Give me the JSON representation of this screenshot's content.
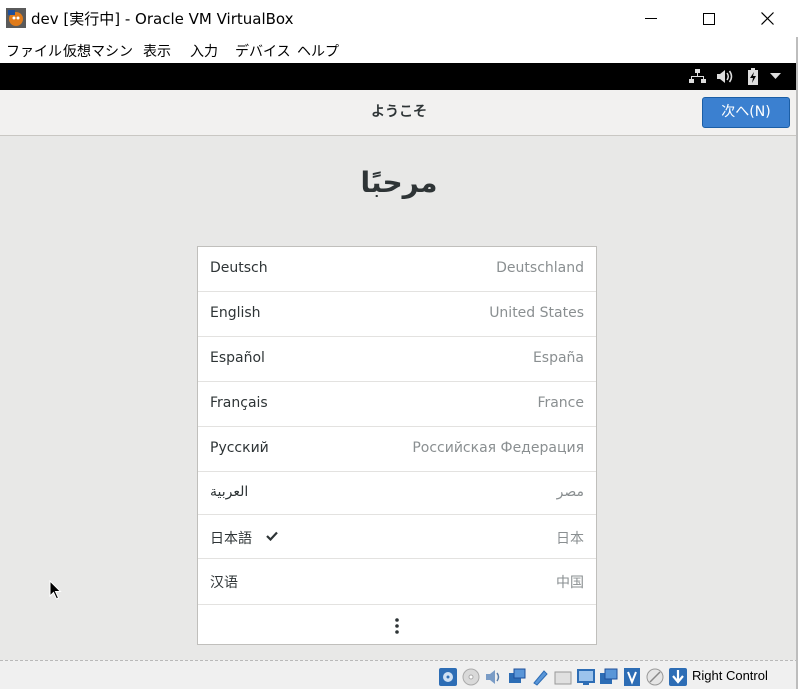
{
  "window": {
    "title": "dev [実行中] - Oracle VM VirtualBox"
  },
  "menubar": {
    "items": [
      "ファイル",
      "仮想マシン",
      "表示",
      "入力",
      "デバイス",
      "ヘルプ"
    ]
  },
  "headerbar": {
    "title": "ようこそ",
    "next_label": "次へ(N)"
  },
  "greeting": "مرحبًا",
  "languages": [
    {
      "name": "Deutsch",
      "country": "Deutschland",
      "selected": false
    },
    {
      "name": "English",
      "country": "United States",
      "selected": false
    },
    {
      "name": "Español",
      "country": "España",
      "selected": false
    },
    {
      "name": "Français",
      "country": "France",
      "selected": false
    },
    {
      "name": "Русский",
      "country": "Российская Федерация",
      "selected": false
    },
    {
      "name": "العربية",
      "country": "مصر",
      "selected": false
    },
    {
      "name": "日本語",
      "country": "日本",
      "selected": true
    },
    {
      "name": "汉语",
      "country": "中国",
      "selected": false
    }
  ],
  "statusbar": {
    "host_key": "Right Control"
  },
  "colors": {
    "accent": "#3b80d0",
    "content_bg": "#e8e8e7",
    "topbar_bg": "#000000"
  }
}
